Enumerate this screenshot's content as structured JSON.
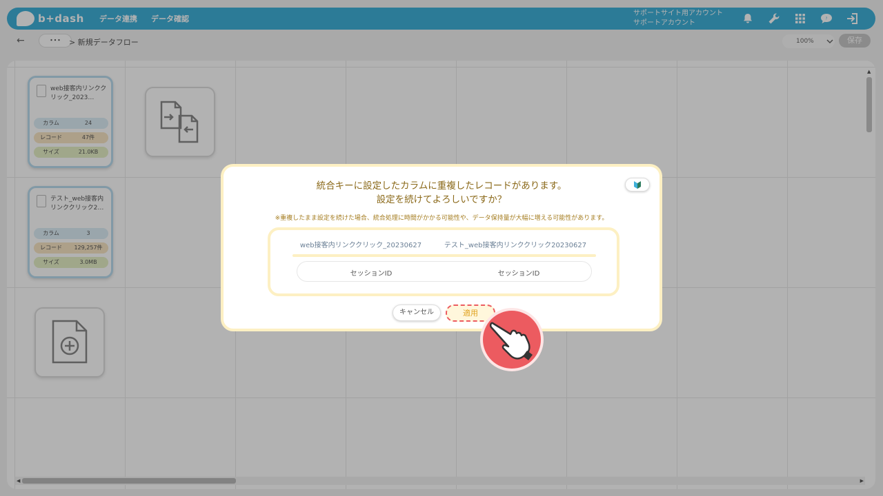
{
  "app": {
    "logo_text": "b+dash"
  },
  "nav": [
    {
      "label": "データ連携"
    },
    {
      "label": "データ確認"
    }
  ],
  "account": {
    "line1": "サポートサイト用アカウント",
    "line2": "サポートアカウント"
  },
  "header_icons": [
    "bell-icon",
    "wrench-icon",
    "grid-icon",
    "chat-icon",
    "logout-icon"
  ],
  "toolbar": {
    "back": "←",
    "more": "･･･",
    "breadcrumb": "> 新規データフロー",
    "zoom": "100%",
    "save": "保存"
  },
  "files": [
    {
      "name": "web接客内リンククリック_2023…",
      "rows": [
        {
          "label": "カラム",
          "value": "24"
        },
        {
          "label": "レコード",
          "value": "47件"
        },
        {
          "label": "サイズ",
          "value": "21.0KB"
        }
      ]
    },
    {
      "name": "テスト_web接客内リンククリック2…",
      "rows": [
        {
          "label": "カラム",
          "value": "3"
        },
        {
          "label": "レコード",
          "value": "129,257件"
        },
        {
          "label": "サイズ",
          "value": "3.0MB"
        }
      ]
    }
  ],
  "modal": {
    "title_line1": "統合キーに設定したカラムに重複したレコードがあります。",
    "title_line2": "設定を続けてよろしいですか？",
    "note": "※重複したまま設定を続けた場合、統合処理に時間がかかる可能性や、データ保持量が大幅に増える可能性があります。",
    "left_file": "web接客内リンククリック_20230627",
    "right_file": "テスト_web接客内リンククリック20230627",
    "left_key": "セッションID",
    "right_key": "セッションID",
    "cancel": "キャンセル",
    "apply": "適用"
  },
  "colors": {
    "header": "#3fb0d9",
    "accent": "#e0a320",
    "highlight": "#ec5b60"
  }
}
